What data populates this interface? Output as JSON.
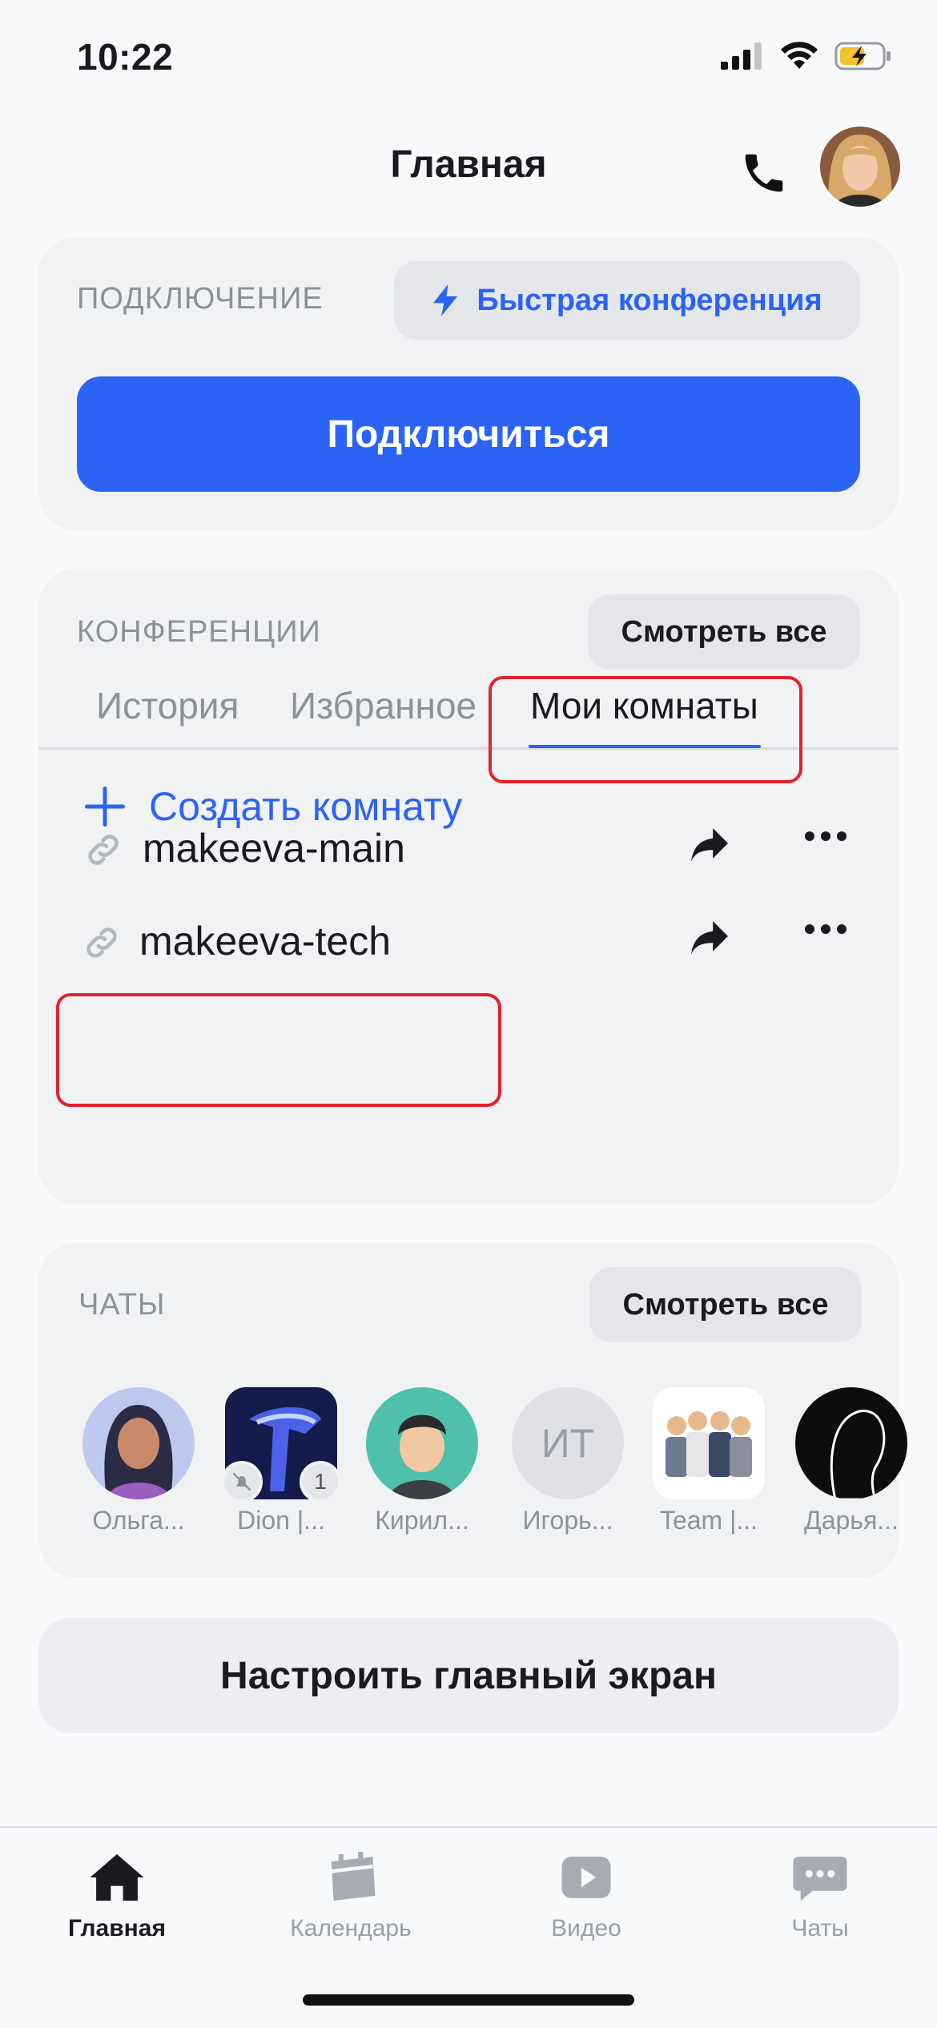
{
  "status_bar": {
    "time": "10:22"
  },
  "header": {
    "title": "Главная"
  },
  "connect_card": {
    "label": "ПОДКЛЮЧЕНИЕ",
    "quick_conference": "Быстрая конференция",
    "connect_button": "Подключиться"
  },
  "conferences": {
    "label": "КОНФЕРЕНЦИИ",
    "see_all": "Смотреть все",
    "tabs": [
      "История",
      "Избранное",
      "Мои комнаты"
    ],
    "active_tab": "Мои комнаты",
    "rooms": [
      {
        "name": "makeeva-main"
      },
      {
        "name": "makeeva-tech"
      }
    ],
    "create_room": "Создать комнату"
  },
  "chats": {
    "label": "ЧАТЫ",
    "see_all": "Смотреть все",
    "items": [
      {
        "caption": "Ольга...",
        "icon": "woman-avatar"
      },
      {
        "caption": "Dion |...",
        "icon": "dion-logo",
        "badge_count": "1"
      },
      {
        "caption": "Кирил...",
        "icon": "man-avatar"
      },
      {
        "caption": "Игорь...",
        "initials": "ИТ"
      },
      {
        "caption": "Team |...",
        "icon": "team-avatar"
      },
      {
        "caption": "Дарья...",
        "icon": "silhouette-avatar"
      }
    ]
  },
  "setup_button": "Настроить главный экран",
  "tabbar": {
    "items": [
      {
        "label": "Главная",
        "icon": "home-icon"
      },
      {
        "label": "Календарь",
        "icon": "calendar-icon"
      },
      {
        "label": "Видео",
        "icon": "video-icon"
      },
      {
        "label": "Чаты",
        "icon": "chat-icon"
      }
    ],
    "active": "Главная"
  },
  "colors": {
    "accent": "#2b63f5",
    "highlight": "#e5202e"
  }
}
